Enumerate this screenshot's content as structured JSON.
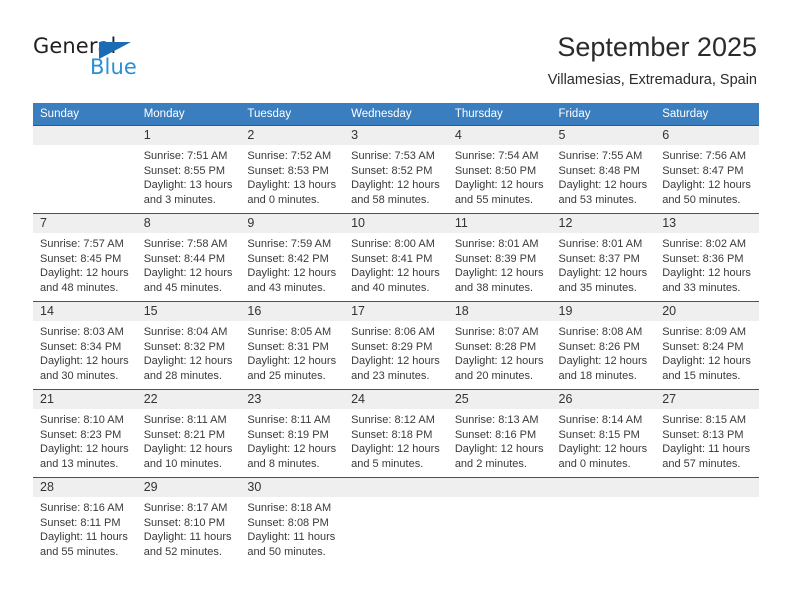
{
  "brand": {
    "name_dark": "General",
    "name_blue": "Blue",
    "triangle_icon": "triangle-icon",
    "accent_dark": "#231f20",
    "accent_blue": "#2b8fd6",
    "triangle_color": "#1b6cb5"
  },
  "header": {
    "title": "September 2025",
    "subtitle": "Villamesias, Extremadura, Spain"
  },
  "theme": {
    "header_row_bg": "#3a7ebf",
    "week_rule": "#1f5c9e",
    "daynum_bg": "#efefef",
    "text": "#3a3a3a"
  },
  "weekday_headers": [
    "Sunday",
    "Monday",
    "Tuesday",
    "Wednesday",
    "Thursday",
    "Friday",
    "Saturday"
  ],
  "weeks": [
    [
      {
        "day": "",
        "sunrise": "",
        "sunset": "",
        "daylight": ""
      },
      {
        "day": "1",
        "sunrise": "Sunrise: 7:51 AM",
        "sunset": "Sunset: 8:55 PM",
        "daylight": "Daylight: 13 hours and 3 minutes."
      },
      {
        "day": "2",
        "sunrise": "Sunrise: 7:52 AM",
        "sunset": "Sunset: 8:53 PM",
        "daylight": "Daylight: 13 hours and 0 minutes."
      },
      {
        "day": "3",
        "sunrise": "Sunrise: 7:53 AM",
        "sunset": "Sunset: 8:52 PM",
        "daylight": "Daylight: 12 hours and 58 minutes."
      },
      {
        "day": "4",
        "sunrise": "Sunrise: 7:54 AM",
        "sunset": "Sunset: 8:50 PM",
        "daylight": "Daylight: 12 hours and 55 minutes."
      },
      {
        "day": "5",
        "sunrise": "Sunrise: 7:55 AM",
        "sunset": "Sunset: 8:48 PM",
        "daylight": "Daylight: 12 hours and 53 minutes."
      },
      {
        "day": "6",
        "sunrise": "Sunrise: 7:56 AM",
        "sunset": "Sunset: 8:47 PM",
        "daylight": "Daylight: 12 hours and 50 minutes."
      }
    ],
    [
      {
        "day": "7",
        "sunrise": "Sunrise: 7:57 AM",
        "sunset": "Sunset: 8:45 PM",
        "daylight": "Daylight: 12 hours and 48 minutes."
      },
      {
        "day": "8",
        "sunrise": "Sunrise: 7:58 AM",
        "sunset": "Sunset: 8:44 PM",
        "daylight": "Daylight: 12 hours and 45 minutes."
      },
      {
        "day": "9",
        "sunrise": "Sunrise: 7:59 AM",
        "sunset": "Sunset: 8:42 PM",
        "daylight": "Daylight: 12 hours and 43 minutes."
      },
      {
        "day": "10",
        "sunrise": "Sunrise: 8:00 AM",
        "sunset": "Sunset: 8:41 PM",
        "daylight": "Daylight: 12 hours and 40 minutes."
      },
      {
        "day": "11",
        "sunrise": "Sunrise: 8:01 AM",
        "sunset": "Sunset: 8:39 PM",
        "daylight": "Daylight: 12 hours and 38 minutes."
      },
      {
        "day": "12",
        "sunrise": "Sunrise: 8:01 AM",
        "sunset": "Sunset: 8:37 PM",
        "daylight": "Daylight: 12 hours and 35 minutes."
      },
      {
        "day": "13",
        "sunrise": "Sunrise: 8:02 AM",
        "sunset": "Sunset: 8:36 PM",
        "daylight": "Daylight: 12 hours and 33 minutes."
      }
    ],
    [
      {
        "day": "14",
        "sunrise": "Sunrise: 8:03 AM",
        "sunset": "Sunset: 8:34 PM",
        "daylight": "Daylight: 12 hours and 30 minutes."
      },
      {
        "day": "15",
        "sunrise": "Sunrise: 8:04 AM",
        "sunset": "Sunset: 8:32 PM",
        "daylight": "Daylight: 12 hours and 28 minutes."
      },
      {
        "day": "16",
        "sunrise": "Sunrise: 8:05 AM",
        "sunset": "Sunset: 8:31 PM",
        "daylight": "Daylight: 12 hours and 25 minutes."
      },
      {
        "day": "17",
        "sunrise": "Sunrise: 8:06 AM",
        "sunset": "Sunset: 8:29 PM",
        "daylight": "Daylight: 12 hours and 23 minutes."
      },
      {
        "day": "18",
        "sunrise": "Sunrise: 8:07 AM",
        "sunset": "Sunset: 8:28 PM",
        "daylight": "Daylight: 12 hours and 20 minutes."
      },
      {
        "day": "19",
        "sunrise": "Sunrise: 8:08 AM",
        "sunset": "Sunset: 8:26 PM",
        "daylight": "Daylight: 12 hours and 18 minutes."
      },
      {
        "day": "20",
        "sunrise": "Sunrise: 8:09 AM",
        "sunset": "Sunset: 8:24 PM",
        "daylight": "Daylight: 12 hours and 15 minutes."
      }
    ],
    [
      {
        "day": "21",
        "sunrise": "Sunrise: 8:10 AM",
        "sunset": "Sunset: 8:23 PM",
        "daylight": "Daylight: 12 hours and 13 minutes."
      },
      {
        "day": "22",
        "sunrise": "Sunrise: 8:11 AM",
        "sunset": "Sunset: 8:21 PM",
        "daylight": "Daylight: 12 hours and 10 minutes."
      },
      {
        "day": "23",
        "sunrise": "Sunrise: 8:11 AM",
        "sunset": "Sunset: 8:19 PM",
        "daylight": "Daylight: 12 hours and 8 minutes."
      },
      {
        "day": "24",
        "sunrise": "Sunrise: 8:12 AM",
        "sunset": "Sunset: 8:18 PM",
        "daylight": "Daylight: 12 hours and 5 minutes."
      },
      {
        "day": "25",
        "sunrise": "Sunrise: 8:13 AM",
        "sunset": "Sunset: 8:16 PM",
        "daylight": "Daylight: 12 hours and 2 minutes."
      },
      {
        "day": "26",
        "sunrise": "Sunrise: 8:14 AM",
        "sunset": "Sunset: 8:15 PM",
        "daylight": "Daylight: 12 hours and 0 minutes."
      },
      {
        "day": "27",
        "sunrise": "Sunrise: 8:15 AM",
        "sunset": "Sunset: 8:13 PM",
        "daylight": "Daylight: 11 hours and 57 minutes."
      }
    ],
    [
      {
        "day": "28",
        "sunrise": "Sunrise: 8:16 AM",
        "sunset": "Sunset: 8:11 PM",
        "daylight": "Daylight: 11 hours and 55 minutes."
      },
      {
        "day": "29",
        "sunrise": "Sunrise: 8:17 AM",
        "sunset": "Sunset: 8:10 PM",
        "daylight": "Daylight: 11 hours and 52 minutes."
      },
      {
        "day": "30",
        "sunrise": "Sunrise: 8:18 AM",
        "sunset": "Sunset: 8:08 PM",
        "daylight": "Daylight: 11 hours and 50 minutes."
      },
      {
        "day": "",
        "sunrise": "",
        "sunset": "",
        "daylight": ""
      },
      {
        "day": "",
        "sunrise": "",
        "sunset": "",
        "daylight": ""
      },
      {
        "day": "",
        "sunrise": "",
        "sunset": "",
        "daylight": ""
      },
      {
        "day": "",
        "sunrise": "",
        "sunset": "",
        "daylight": ""
      }
    ]
  ]
}
